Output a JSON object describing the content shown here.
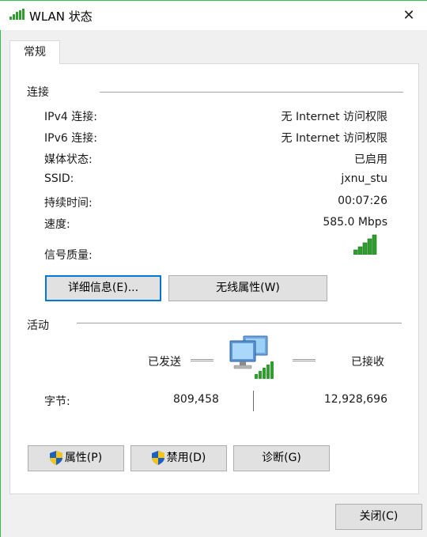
{
  "window": {
    "title": "WLAN 状态",
    "close_glyph": "✕"
  },
  "tabs": [
    {
      "label": "常规"
    }
  ],
  "connection": {
    "section_label": "连接",
    "rows": [
      {
        "label": "IPv4 连接:",
        "value": "无 Internet 访问权限"
      },
      {
        "label": "IPv6 连接:",
        "value": "无 Internet 访问权限"
      },
      {
        "label": "媒体状态:",
        "value": "已启用"
      },
      {
        "label": "SSID:",
        "value": "jxnu_stu"
      },
      {
        "label": "持续时间:",
        "value": "00:07:26"
      },
      {
        "label": "速度:",
        "value": "585.0 Mbps"
      }
    ],
    "signal_label": "信号质量:",
    "signal_bars": 5,
    "details_button": "详细信息(E)...",
    "wireless_button": "无线属性(W)"
  },
  "activity": {
    "section_label": "活动",
    "sent_label": "已发送",
    "received_label": "已接收",
    "bytes_label": "字节:",
    "bytes_sent": "809,458",
    "bytes_received": "12,928,696"
  },
  "buttons": {
    "properties": "属性(P)",
    "disable": "禁用(D)",
    "diagnose": "诊断(G)",
    "close": "关闭(C)"
  },
  "colors": {
    "accent_green": "#2ec24f",
    "signal_green": "#2e9e2e",
    "focus_blue": "#0078d7"
  }
}
